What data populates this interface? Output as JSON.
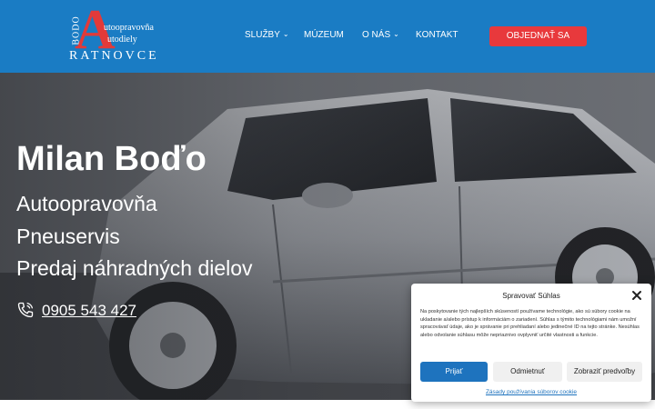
{
  "header": {
    "logo": {
      "big_letter": "A",
      "vertical_text": "BODO",
      "line1": "utoopravovňa",
      "line2": "utodiely",
      "city": "RATNOVCE"
    },
    "nav": [
      {
        "label": "SLUŽBY",
        "has_dropdown": true
      },
      {
        "label": "MÚZEUM",
        "has_dropdown": false
      },
      {
        "label": "O NÁS",
        "has_dropdown": true
      },
      {
        "label": "KONTAKT",
        "has_dropdown": false
      }
    ],
    "cta_label": "OBJEDNAŤ SA"
  },
  "hero": {
    "title": "Milan Boďo",
    "lines": [
      "Autoopravovňa",
      "Pneuservis",
      "Predaj náhradných dielov"
    ],
    "phone": "0905 543 427",
    "phone_icon": "phone-icon"
  },
  "cookie": {
    "title": "Spravovať Súhlas",
    "text": "Na poskytovanie tých najlepších skúseností používame technológie, ako sú súbory cookie na ukladanie a/alebo prístup k informáciám o zariadení. Súhlas s týmito technológiami nám umožní spracovávať údaje, ako je správanie pri prehliadaní alebo jedinečné ID na tejto stránke. Nesúhlas alebo odvolanie súhlasu môže nepriaznivo ovplyvniť určité vlastnosti a funkcie.",
    "accept_label": "Prijať",
    "deny_label": "Odmietnuť",
    "prefs_label": "Zobraziť predvoľby",
    "policy_link": "Zásady používania súborov cookie",
    "close_icon": "close-icon"
  },
  "colors": {
    "header_bg": "#1a7cc4",
    "cta_bg": "#e8393c",
    "logo_accent": "#e23a3a",
    "accept_bg": "#1e73be"
  }
}
